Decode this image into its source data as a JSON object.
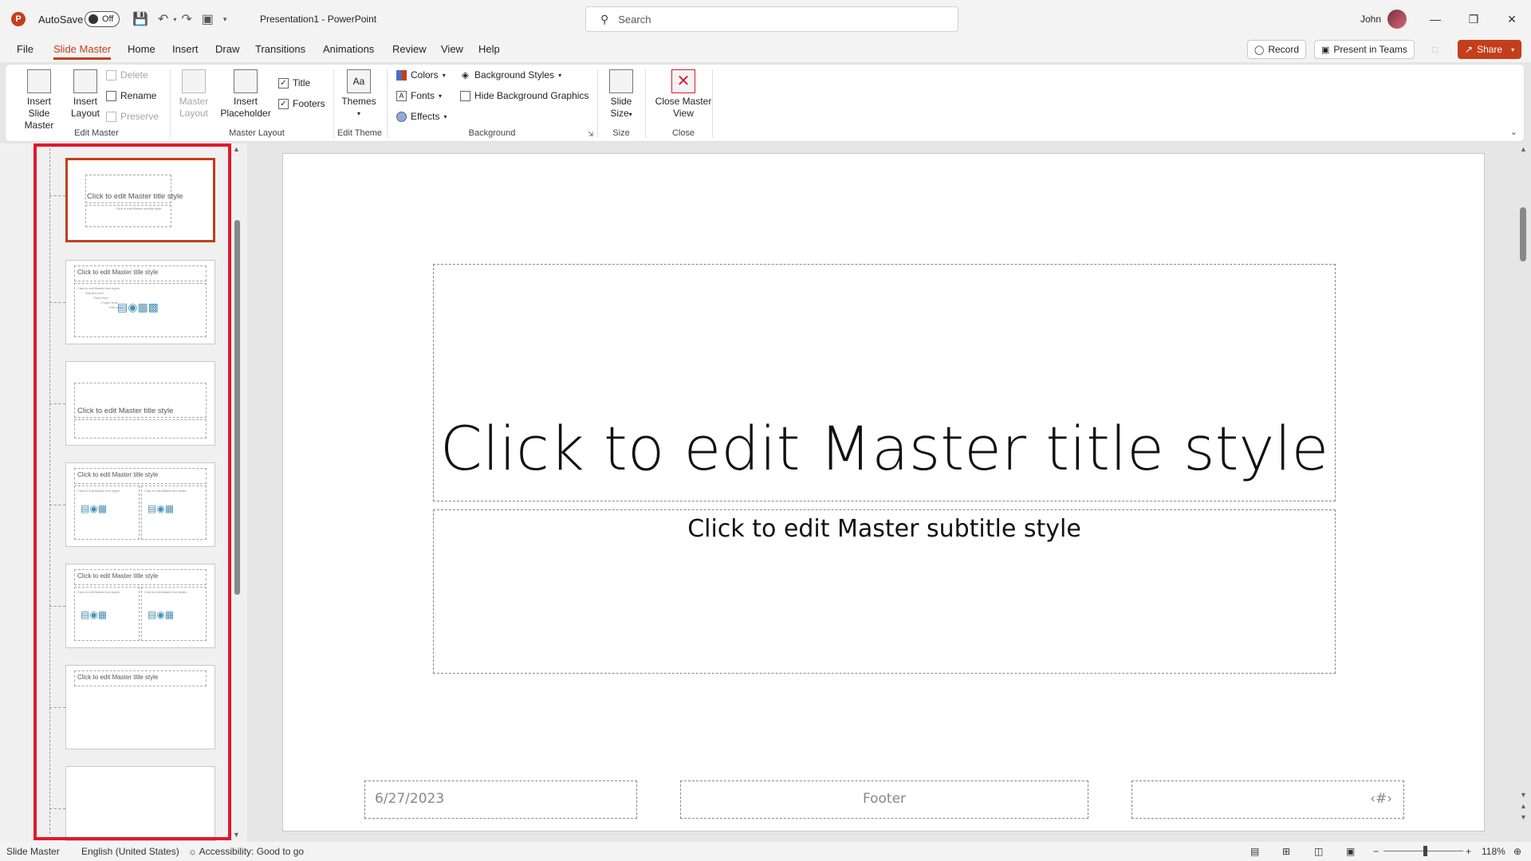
{
  "titlebar": {
    "app_logo": "P",
    "autosave_label": "AutoSave",
    "autosave_state": "Off",
    "document_title": "Presentation1 - PowerPoint",
    "search_placeholder": "Search",
    "user_name": "John",
    "icons": [
      "save-icon",
      "undo-icon",
      "redo-icon",
      "present-icon",
      "customize-icon"
    ]
  },
  "menu": {
    "tabs": [
      "File",
      "Slide Master",
      "Home",
      "Insert",
      "Draw",
      "Transitions",
      "Animations",
      "Review",
      "View",
      "Help"
    ],
    "active_tab": "Slide Master",
    "record_label": "Record",
    "present_teams_label": "Present in Teams",
    "share_label": "Share"
  },
  "ribbon": {
    "insert_slide_master": "Insert Slide Master",
    "insert_layout": "Insert Layout",
    "delete": "Delete",
    "rename": "Rename",
    "preserve": "Preserve",
    "group_edit_master": "Edit Master",
    "master_layout": "Master Layout",
    "insert_placeholder": "Insert Placeholder",
    "title_check": "Title",
    "footers_check": "Footers",
    "group_master_layout": "Master Layout",
    "themes": "Themes",
    "group_edit_theme": "Edit Theme",
    "colors": "Colors",
    "fonts": "Fonts",
    "effects": "Effects",
    "background_styles": "Background Styles",
    "hide_bg_graphics": "Hide Background Graphics",
    "group_background": "Background",
    "slide_size": "Slide Size",
    "group_size": "Size",
    "close_master_view": "Close Master View",
    "group_close": "Close",
    "accent": "#c43e1c"
  },
  "thumbnails": {
    "master_title": "Click to edit Master title style",
    "master_subtitle": "Click to edit Master subtitle style",
    "text_styles": "Click to edit Master text styles",
    "second": "Second level",
    "third": "Third level",
    "fourth": "Fourth level",
    "fifth": "Fifth level"
  },
  "slide": {
    "title": "Click to edit Master title style",
    "subtitle": "Click to edit Master subtitle style",
    "date": "6/27/2023",
    "footer": "Footer",
    "page_number": "‹#›"
  },
  "statusbar": {
    "view": "Slide Master",
    "language": "English (United States)",
    "accessibility": "Accessibility: Good to go",
    "zoom": "118%"
  }
}
